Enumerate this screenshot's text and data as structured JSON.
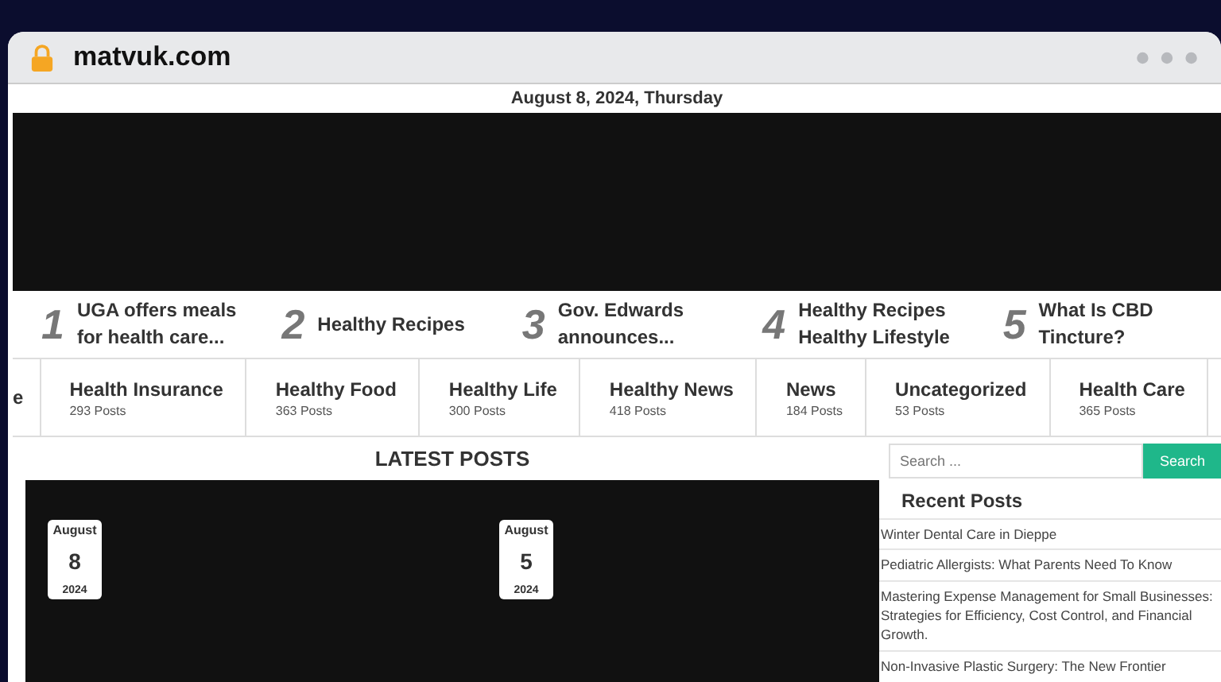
{
  "browser": {
    "url": "matvuk.com"
  },
  "date_line": "August 8, 2024, Thursday",
  "trending": [
    {
      "number": "1",
      "title": "UGA offers meals for health care..."
    },
    {
      "number": "2",
      "title": "Healthy Recipes"
    },
    {
      "number": "3",
      "title": "Gov. Edwards announces..."
    },
    {
      "number": "4",
      "title": "Healthy Recipes Healthy Lifestyle"
    },
    {
      "number": "5",
      "title": "What Is CBD Tincture?"
    }
  ],
  "categories": [
    {
      "name": "e"
    },
    {
      "name": "Health Insurance",
      "count": "293 Posts"
    },
    {
      "name": "Healthy Food",
      "count": "363 Posts"
    },
    {
      "name": "Healthy Life",
      "count": "300 Posts"
    },
    {
      "name": "Healthy News",
      "count": "418 Posts"
    },
    {
      "name": "News",
      "count": "184 Posts"
    },
    {
      "name": "Uncategorized",
      "count": "53 Posts"
    },
    {
      "name": "Health Care",
      "count": "365 Posts"
    }
  ],
  "latest_posts": {
    "heading": "LATEST POSTS",
    "posts": [
      {
        "month": "August",
        "day": "8",
        "year": "2024"
      },
      {
        "month": "August",
        "day": "5",
        "year": "2024"
      }
    ]
  },
  "sidebar": {
    "search": {
      "placeholder": "Search ...",
      "button": "Search"
    },
    "recent_heading": "Recent Posts",
    "recent_posts": [
      "Winter Dental Care in Dieppe",
      "Pediatric Allergists: What Parents Need To Know",
      "Mastering Expense Management for Small Businesses: Strategies for Efficiency, Cost Control, and Financial Growth.",
      "Non-Invasive Plastic Surgery: The New Frontier"
    ]
  }
}
